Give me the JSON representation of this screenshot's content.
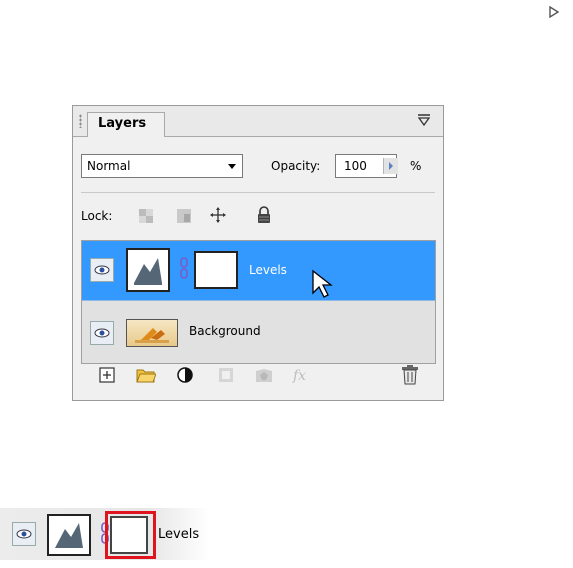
{
  "panel": {
    "tab_title": "Layers",
    "blend_mode": "Normal",
    "opacity_label": "Opacity:",
    "opacity_value": "100",
    "percent": "%",
    "lock_label": "Lock:"
  },
  "layers": [
    {
      "name": "Levels",
      "selected": true,
      "visible": true
    },
    {
      "name": "Background",
      "selected": false,
      "visible": true
    }
  ],
  "bottom_icons": [
    "new-layer-icon",
    "new-group-icon",
    "adjustment-layer-icon",
    "add-mask-icon",
    "fill-layer-icon",
    "fx-icon",
    "trash-icon"
  ],
  "strip": {
    "label": "Levels",
    "highlight_color": "#e0141e"
  },
  "colors": {
    "selection": "#3399ff",
    "panel_bg": "#f0f0f0"
  }
}
